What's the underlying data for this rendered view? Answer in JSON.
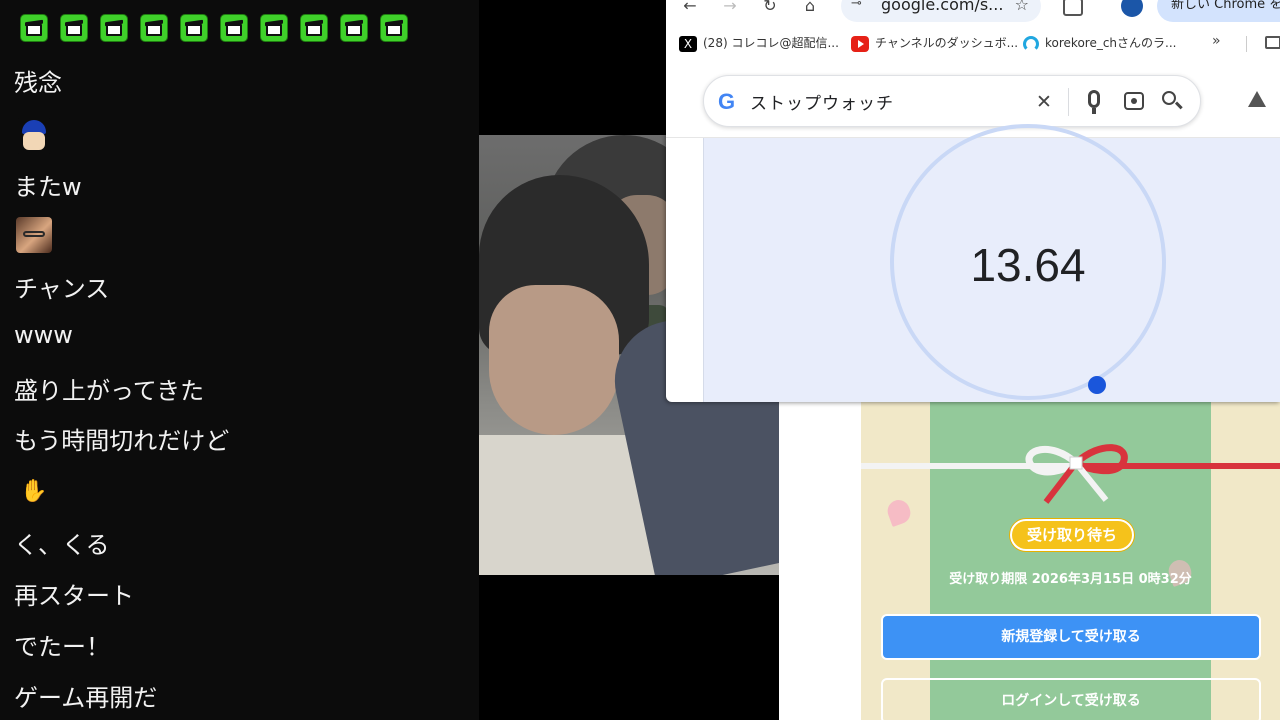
{
  "chat": {
    "emote_count": 10,
    "messages": [
      "残念",
      "またw",
      "チャンス",
      "www",
      "盛り上がってきた",
      "もう時間切れだけど",
      "く、くる",
      "再スタート",
      "でたー！",
      "ゲーム再開だ"
    ]
  },
  "browser": {
    "url": "google.com/s...",
    "promo_label": "新しい Chrome をご",
    "bookmarks": [
      {
        "label": "(28) コレコレ@超配信...",
        "icon": "x-icon"
      },
      {
        "label": "チャンネルのダッシュボ...",
        "icon": "youtube-icon"
      },
      {
        "label": "korekore_chさんのラ...",
        "icon": "twitcasting-icon"
      }
    ],
    "more_label": "»",
    "search_query": "ストップウォッチ",
    "google_logo": "G",
    "clear_icon": "✕",
    "stopwatch_time": "13.64"
  },
  "gift_card": {
    "status_badge": "受け取り待ち",
    "deadline": "受け取り期限 2026年3月15日 0時32分",
    "primary_button": "新規登録して受け取る",
    "secondary_button": "ログインして受け取る"
  },
  "colors": {
    "emote_green": "#3fd12a",
    "card_green": "#93c99a",
    "badge_yellow": "#f5c21b",
    "primary_blue": "#3d92f5",
    "stopwatch_bg": "#e8edfb"
  }
}
